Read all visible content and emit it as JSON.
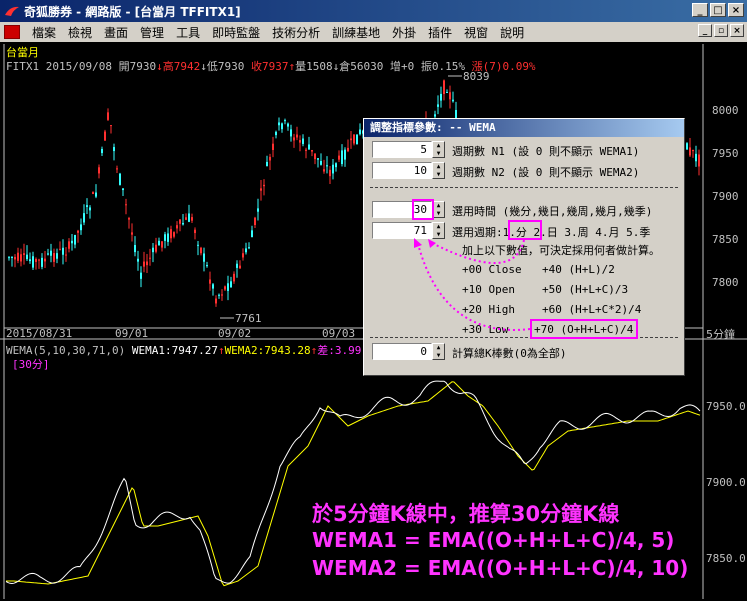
{
  "window": {
    "title": "奇狐勝券 - 網路版 - [台當月 TFFITX1]",
    "min": "_",
    "max": "□",
    "close": "×"
  },
  "menu": [
    "檔案",
    "檢視",
    "畫面",
    "管理",
    "工具",
    "即時監盤",
    "技術分析",
    "訓練基地",
    "外掛",
    "插件",
    "視窗",
    "說明"
  ],
  "chart": {
    "symbol_name": "台當月",
    "quote_prefix": "FITX1 2015/09/08 開7930",
    "high": "↓高7942",
    "low": "↓低7930",
    "close": "收7937",
    "up_arrow": "↑",
    "volume": "量1508",
    "oi": "↓倉56030",
    "oi_change": "增+0",
    "amplitude": "振0.15%",
    "change": "漲(7)0.09%",
    "peak_label": "8039",
    "trough_label": "7761",
    "price_ticks": [
      "8000",
      "7950",
      "7900",
      "7850",
      "7800"
    ],
    "date_labels": [
      "2015/08/31",
      "09/01",
      "09/02",
      "09/03"
    ],
    "period_label": "5分鐘",
    "indicator_line": "WEMA(5,10,30,71,0)",
    "wema1": "WEMA1:7947.27",
    "wema2": "WEMA2:7943.28",
    "diff": "差:3.99",
    "indicator_period": "[30分]",
    "indicator_ticks": [
      "7950.0",
      "7900.0",
      "7850.0"
    ]
  },
  "dialog": {
    "title": "調整指標參數: -- WEMA",
    "n1_value": "5",
    "n1_label": "週期數 N1 (設 0 則不顯示 WEMA1)",
    "n2_value": "10",
    "n2_label": "週期數 N2 (設 0 則不顯示 WEMA2)",
    "time_value": "30",
    "time_label": "選用時間 (幾分,幾日,幾周,幾月,幾季)",
    "period_value": "71",
    "period_prefix": "選用週期:",
    "period_choice": "1.分",
    "period_rest": "2.日 3.周 4.月 5.季",
    "hint": "加上以下數值，可決定採用何者做計算。",
    "opt1": "+00 Close",
    "opt2": "+40 (H+L)/2",
    "opt3": "+10 Open",
    "opt4": "+50 (H+L+C)/3",
    "opt5": "+20 High",
    "opt6": "+60 (H+L+C*2)/4",
    "opt7": "+30 Low",
    "opt8": "+70 (O+H+L+C)/4",
    "count_value": "0",
    "count_label": "計算總K棒數(0為全部)"
  },
  "annotation": {
    "line1": "於5分鐘K線中，推算30分鐘K線",
    "line2": "WEMA1 = EMA((O+H+L+C)/4, 5)",
    "line3": "WEMA2 = EMA((O+H+L+C)/4, 10)"
  },
  "colors": {
    "up": "#ff3030",
    "down": "#33ffff",
    "grid": "#606060",
    "axis": "#c0c0c0",
    "wema1": "#ffffff",
    "wema2": "#ffff00",
    "accent": "#ff00ff"
  }
}
